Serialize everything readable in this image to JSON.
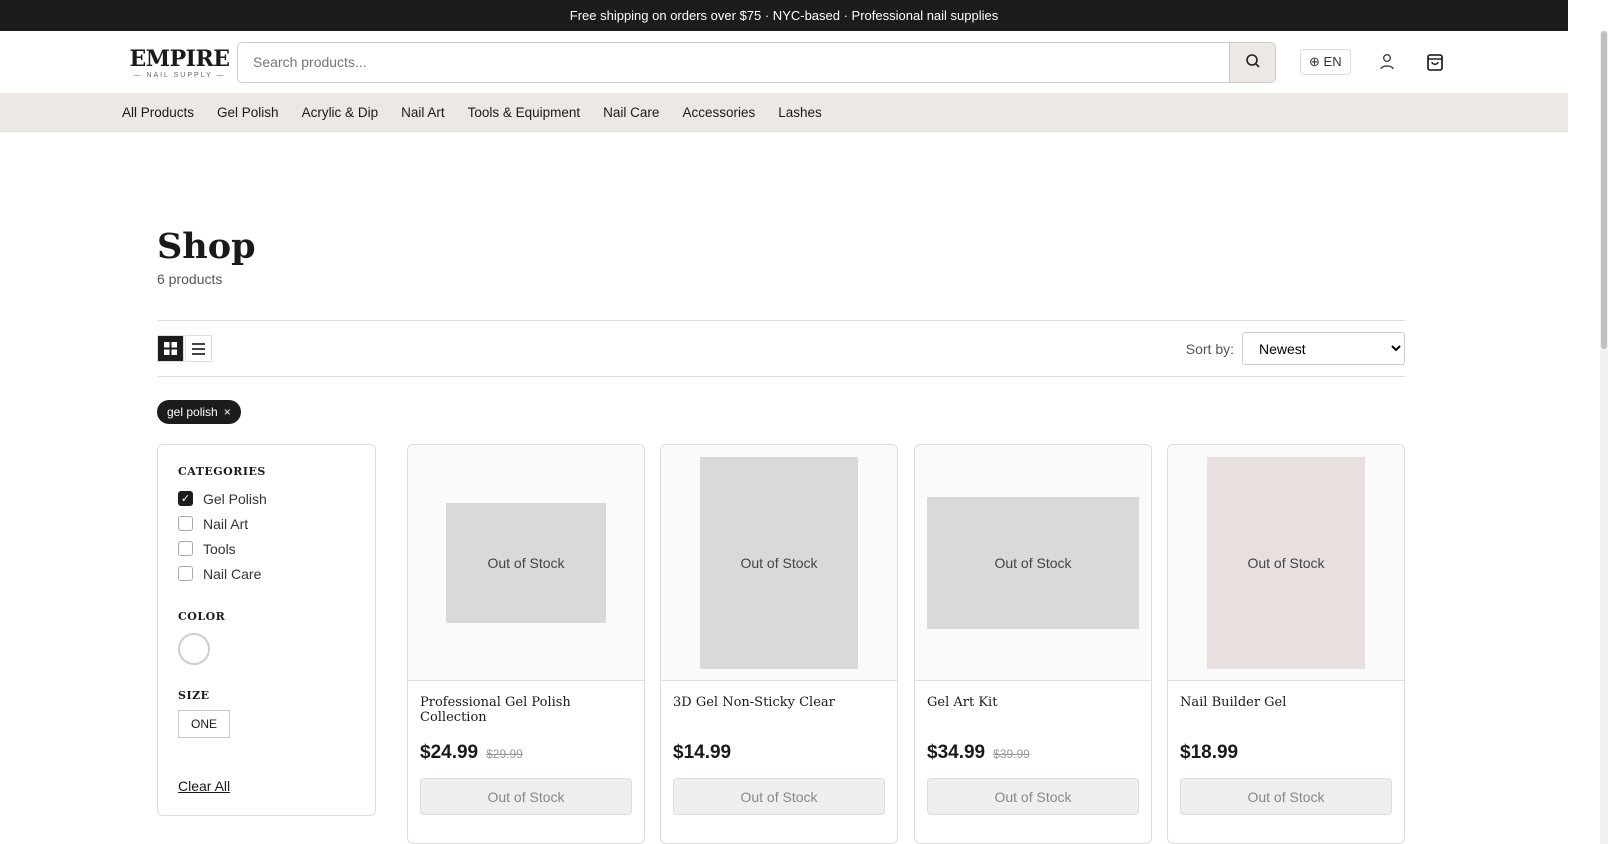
{
  "announcement": "Free shipping on orders over $75  ·  NYC-based  ·  Professional nail supplies",
  "logo": {
    "name": "EMPIRE",
    "tagline": "— NAIL SUPPLY —"
  },
  "search": {
    "placeholder": "Search products..."
  },
  "lang": "EN",
  "nav": [
    "All Products",
    "Gel Polish",
    "Acrylic & Dip",
    "Nail Art",
    "Tools & Equipment",
    "Nail Care",
    "Accessories",
    "Lashes"
  ],
  "page": {
    "title": "Shop",
    "count": "6 products"
  },
  "sort": {
    "label": "Sort by:",
    "value": "Newest"
  },
  "chip": {
    "label": "gel polish",
    "remove": "×"
  },
  "filters": {
    "categories_title": "CATEGORIES",
    "categories": [
      {
        "label": "Gel Polish",
        "checked": true
      },
      {
        "label": "Nail Art",
        "checked": false
      },
      {
        "label": "Tools",
        "checked": false
      },
      {
        "label": "Nail Care",
        "checked": false
      }
    ],
    "color_title": "COLOR",
    "size_title": "SIZE",
    "size": "ONE",
    "clear": "Clear All"
  },
  "products": [
    {
      "title": "Professional Gel Polish Collection",
      "price": "$24.99",
      "old": "$29.99",
      "overlay": "Out of Stock",
      "button": "Out of Stock"
    },
    {
      "title": "3D Gel Non-Sticky Clear",
      "price": "$14.99",
      "old": "",
      "overlay": "Out of Stock",
      "button": "Out of Stock"
    },
    {
      "title": "Gel Art Kit",
      "price": "$34.99",
      "old": "$39.99",
      "overlay": "Out of Stock",
      "button": "Out of Stock"
    },
    {
      "title": "Nail Builder Gel",
      "price": "$18.99",
      "old": "",
      "overlay": "Out of Stock",
      "button": "Out of Stock"
    }
  ]
}
